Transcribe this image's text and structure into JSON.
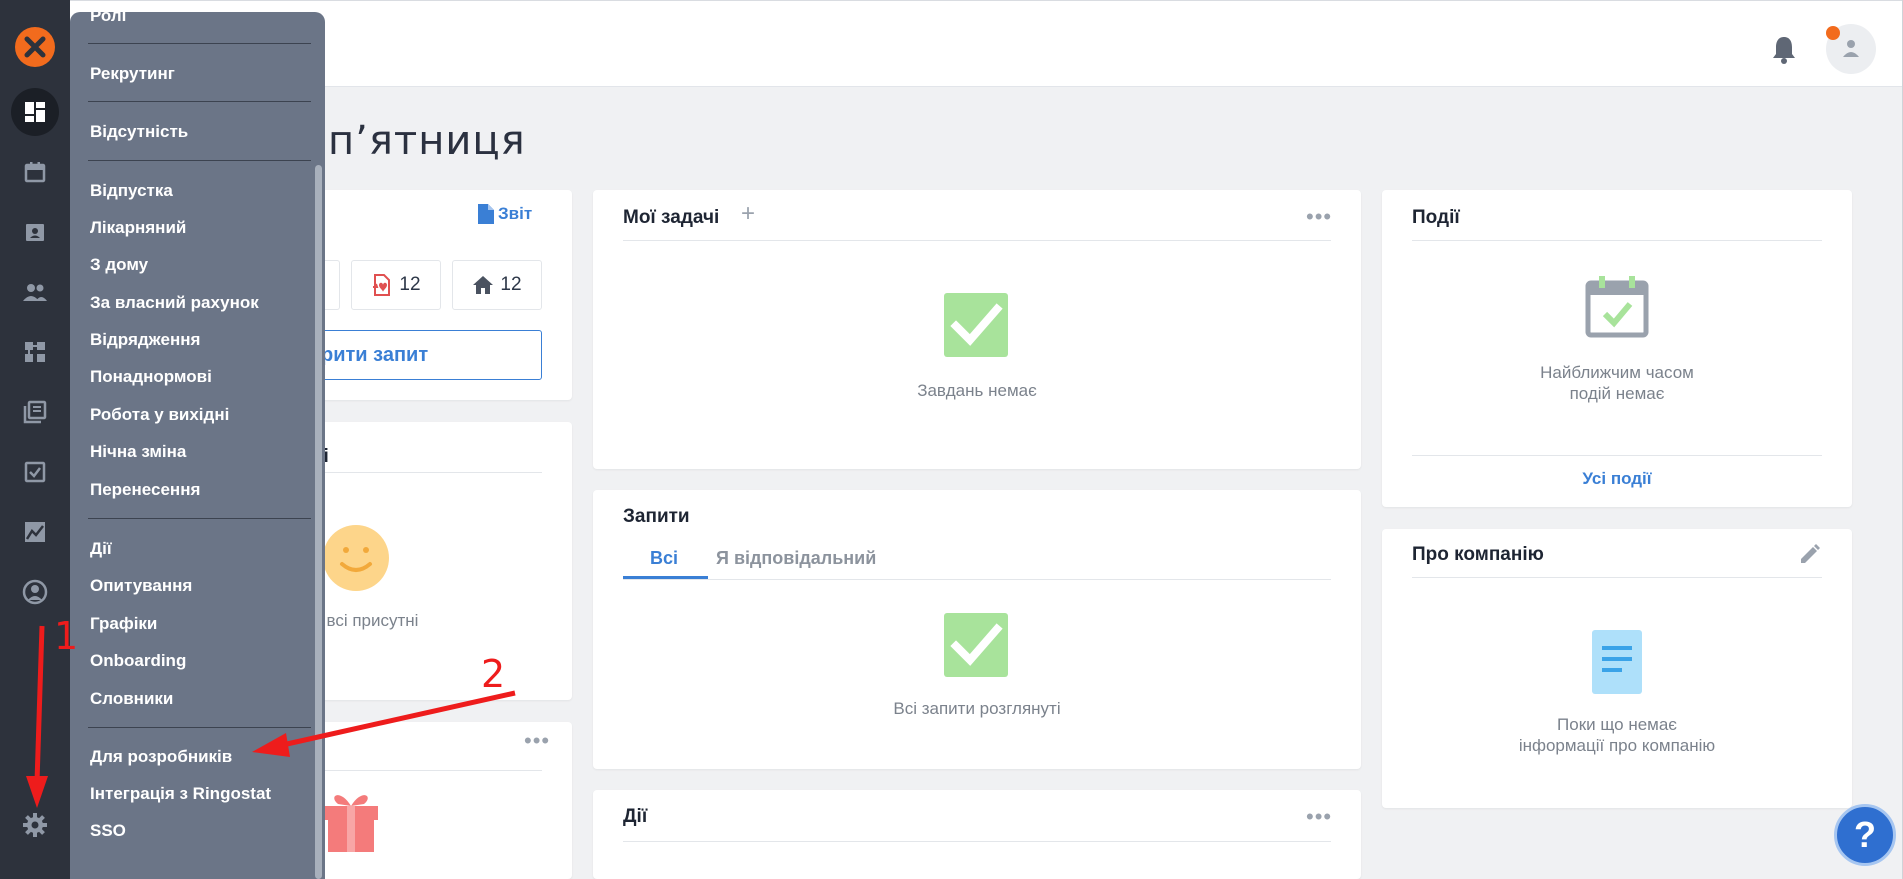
{
  "page": {
    "title": "п’ятниця"
  },
  "absence_card": {
    "report_label": "Звіт",
    "stats": [
      {
        "icon": "sick-leave-icon",
        "value": "12"
      },
      {
        "icon": "home-icon",
        "value": "12"
      }
    ],
    "create_request_label": "рити запит"
  },
  "present_card": {
    "title_fragment": "ні",
    "empty_text": "і всі присутні"
  },
  "tasks_card": {
    "title": "Мої задачі",
    "empty_text": "Завдань немає"
  },
  "requests_card": {
    "title": "Запити",
    "tabs": [
      "Всі",
      "Я відповідальний"
    ],
    "empty_text": "Всі запити розглянуті"
  },
  "actions_card": {
    "title": "Дії"
  },
  "events_card": {
    "title": "Події",
    "empty_line1": "Найближчим часом",
    "empty_line2": "подій немає",
    "all_events_link": "Усі події"
  },
  "company_card": {
    "title": "Про компанію",
    "empty_line1": "Поки що немає",
    "empty_line2": "інформації про компанію"
  },
  "menu": {
    "items": [
      "Ролі",
      "Рекрутинг",
      "Відсутність",
      "Відпустка",
      "Лікарняний",
      "З дому",
      "За власний рахунок",
      "Відрядження",
      "Понаднормові",
      "Робота у вихідні",
      "Нічна зміна",
      "Перенесення",
      "Дії",
      "Опитування",
      "Графіки",
      "Onboarding",
      "Словники",
      "Для розробників",
      "Інтеграція з Ringostat",
      "SSO"
    ]
  },
  "annotations": {
    "step1": "1",
    "step2": "2"
  },
  "help": {
    "label": "?"
  },
  "colors": {
    "accent": "#3a7fd5",
    "brand": "#f26b1d",
    "rail": "#2d323c",
    "menu": "#6b7587",
    "annotation": "#ee1c1c",
    "success": "#a8e39b"
  }
}
